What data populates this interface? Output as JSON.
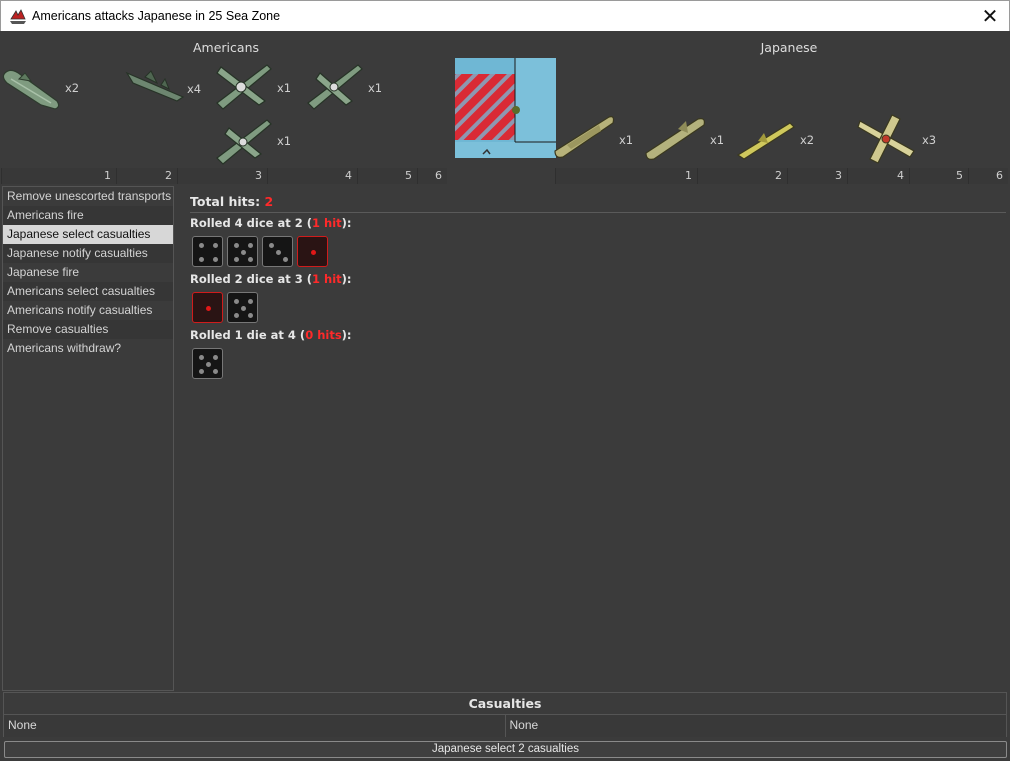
{
  "window": {
    "title": "Americans attacks Japanese in 25 Sea Zone",
    "close_glyph": "✕"
  },
  "attacker": {
    "label": "Americans",
    "units": [
      {
        "icon": "submarine-icon",
        "count": "x2"
      },
      {
        "icon": "destroyer-icon",
        "count": "x4"
      },
      {
        "icon": "bomber-icon",
        "count": "x1"
      },
      {
        "icon": "fighter-icon",
        "count": "x1"
      },
      {
        "icon": "fighter-icon",
        "count": "x1"
      }
    ],
    "ruler": [
      "1",
      "2",
      "3",
      "4",
      "5",
      "6"
    ]
  },
  "defender": {
    "label": "Japanese",
    "units": [
      {
        "icon": "transport-icon",
        "count": "x1"
      },
      {
        "icon": "submarine-icon",
        "count": "x1"
      },
      {
        "icon": "destroyer-icon",
        "count": "x2"
      },
      {
        "icon": "fighter-icon",
        "count": "x3"
      }
    ],
    "ruler": [
      "1",
      "2",
      "3",
      "4",
      "5",
      "6"
    ]
  },
  "steps": [
    {
      "label": "Remove unescorted transports",
      "selected": false
    },
    {
      "label": "Americans fire",
      "selected": false
    },
    {
      "label": "Japanese select casualties",
      "selected": true
    },
    {
      "label": "Japanese notify casualties",
      "selected": false
    },
    {
      "label": "Japanese fire",
      "selected": false
    },
    {
      "label": "Americans select casualties",
      "selected": false
    },
    {
      "label": "Americans notify casualties",
      "selected": false
    },
    {
      "label": "Remove casualties",
      "selected": false
    },
    {
      "label": "Americans withdraw?",
      "selected": false
    }
  ],
  "results": {
    "total_label": "Total hits:",
    "total_hits": "2",
    "rolls": [
      {
        "prefix": "Rolled 4 dice at 2 (",
        "hits": "1 hit",
        "suffix": "):",
        "dice": [
          4,
          5,
          3,
          1
        ],
        "hit_flags": [
          false,
          false,
          false,
          true
        ]
      },
      {
        "prefix": "Rolled 2 dice at 3 (",
        "hits": "1 hit",
        "suffix": "):",
        "dice": [
          1,
          5
        ],
        "hit_flags": [
          true,
          false
        ]
      },
      {
        "prefix": "Rolled 1 die at 4 (",
        "hits": "0 hits",
        "suffix": "):",
        "dice": [
          5
        ],
        "hit_flags": [
          false
        ]
      }
    ]
  },
  "casualties": {
    "header": "Casualties",
    "attacker_value": "None",
    "defender_value": "None"
  },
  "action": {
    "label": "Japanese select 2 casualties"
  },
  "colors": {
    "hit_red": "#ff2a2a",
    "background": "#3b3b3b",
    "american_unit": "#6f8a6e",
    "japanese_unit": "#b9b46a"
  }
}
